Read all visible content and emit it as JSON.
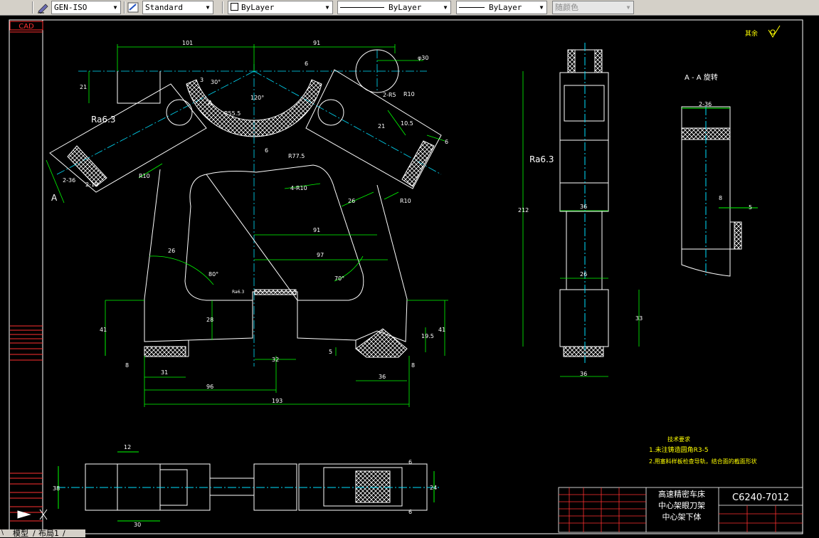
{
  "toolbar": {
    "dimstyle": "GEN-ISO",
    "textstyle": "Standard",
    "color": "ByLayer",
    "linetype": "ByLayer",
    "lineweight": "ByLayer",
    "plotstyle": "随颜色"
  },
  "drawing": {
    "side_label_cad": "CAD",
    "section_label": "A - A 旋转",
    "view_label_a": "A",
    "roughness_top": "其余",
    "roughness_mark": "Ra6.3",
    "tech_title": "技术要求",
    "tech_note_1": "1.未注铸造圆角R3-5",
    "tech_note_2": "2.用塞料样板检查导轨，结合面的截面形状",
    "title_block_name_1": "高速精密车床",
    "title_block_name_2": "中心架眼刀架",
    "title_block_name_3": "中心架下体",
    "drawing_number": "C6240-7012",
    "dims": {
      "d101": "101",
      "d91a": "91",
      "d6": "6",
      "d30dia": "φ30",
      "d21": "21",
      "d3": "3",
      "d30deg": "30°",
      "r555": "R55.5",
      "deg120": "120°",
      "r2r5": "2-R5",
      "r10a": "R10",
      "d21b": "21",
      "d105": "10.5",
      "d6b": "6",
      "r775": "R77.5",
      "d2_36": "2-36",
      "d2_18": "2-18",
      "r10b": "R10",
      "r4r10": "4-R10",
      "r10c": "R10",
      "d26a": "26",
      "d91b": "91",
      "d97": "97",
      "d26b": "26",
      "deg80": "80°",
      "deg70": "70°",
      "d41a": "41",
      "d28": "28",
      "d5": "5",
      "d195": "19.5",
      "d41b": "41",
      "d8a": "8",
      "d31": "31",
      "d32": "32",
      "d36a": "36",
      "d8b": "8",
      "d96": "96",
      "d193": "193",
      "d212": "212",
      "d36b": "36",
      "d26c": "26",
      "d33": "33",
      "d36c": "36",
      "d2_36b": "2-36",
      "d8c": "8",
      "d5b": "5",
      "d12": "12",
      "d38": "38",
      "d30": "30",
      "d6c": "6",
      "d24": "24",
      "d6d": "6"
    }
  },
  "tabs": {
    "model": "模型",
    "layout1": "布局1"
  }
}
